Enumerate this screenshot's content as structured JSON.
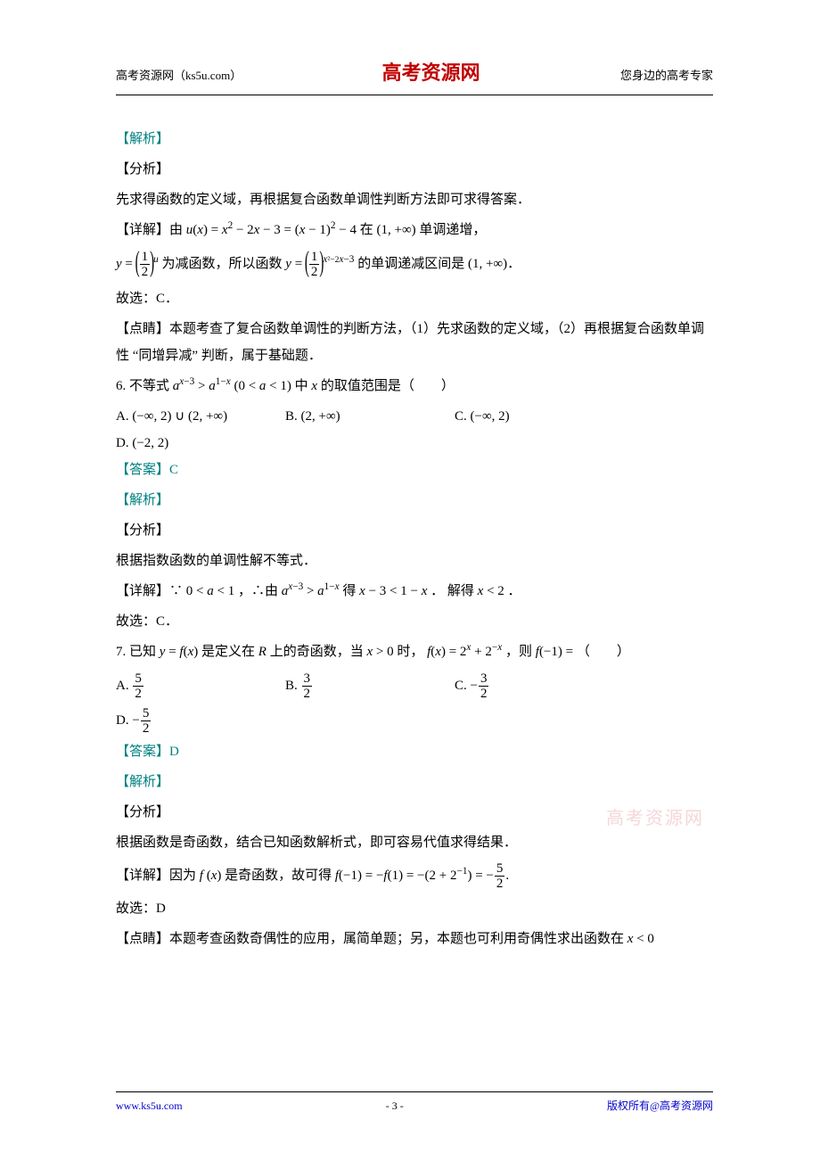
{
  "header": {
    "left": "高考资源网（ks5u.com）",
    "center": "高考资源网",
    "right": "您身边的高考专家"
  },
  "body": {
    "l1": "【解析】",
    "l2": "【分析】",
    "l3": "先求得函数的定义域，再根据复合函数单调性判断方法即可求得答案．",
    "l4a": "【详解】由",
    "l4b": "在",
    "l4c": "单调递增，",
    "l5a": "为减函数，所以函数",
    "l5b": "的单调递减区间是",
    "l6": "故选：C．",
    "l7": "【点睛】本题考查了复合函数单调性的判断方法，（1）先求函数的定义域，（2）再根据复合函数单调性 “同增异减” 判断，属于基础题．",
    "q6": "6. 不等式",
    "q6mid": "中",
    "q6end": "的取值范围是（　　）",
    "q6A": "A.",
    "q6B": "B.",
    "q6C": "C.",
    "q6D": "D.",
    "ans6": "【答案】C",
    "jx6": "【解析】",
    "fx6": "【分析】",
    "t6a": "根据指数函数的单调性解不等式．",
    "t6b_pre": "【详解】∵",
    "t6b_mid1": "，∴由",
    "t6b_mid2": "得",
    "t6b_mid3": "． 解得",
    "t6c": "故选：C．",
    "q7a": "7. 已知",
    "q7b": "是定义在",
    "q7c": "上的奇函数，当",
    "q7d": "时，",
    "q7e": "，则",
    "q7f": "（　　）",
    "q7A": "A.",
    "q7B": "B.",
    "q7C": "C.",
    "q7D": "D.",
    "ans7": "【答案】D",
    "jx7": "【解析】",
    "fx7": "【分析】",
    "t7a": "根据函数是奇函数，结合已知函数解析式，即可容易代值求得结果．",
    "t7b_pre": "【详解】因为",
    "t7b_mid1": "是奇函数，故可得",
    "t7c": "故选：D",
    "t7d": "【点睛】本题考查函数奇偶性的应用，属简单题；另，本题也可利用奇偶性求出函数在"
  },
  "footer": {
    "left": "www.ks5u.com",
    "center": "- 3 -",
    "right": "版权所有@高考资源网"
  },
  "watermark": "高考资源网"
}
